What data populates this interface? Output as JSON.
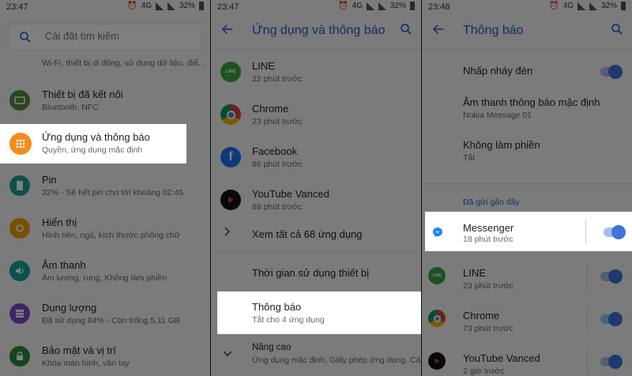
{
  "status": {
    "panel1_time": "23:47",
    "panel2_time": "23:47",
    "panel3_time": "23:48",
    "network": "4G",
    "battery": "32%"
  },
  "panel1": {
    "search_placeholder": "Cài đặt tìm kiếm",
    "partial_top_subtitle": "Wi-Fi, thiết bị di động, sử dụng dữ liệu, điể...",
    "items": [
      {
        "title": "Thiết bị đã kết nối",
        "subtitle": "Bluetooth, NFC",
        "color": "#5b8c3a"
      },
      {
        "title": "Ứng dụng và thông báo",
        "subtitle": "Quyền, ứng dụng mặc định",
        "color": "#f48c1c"
      },
      {
        "title": "Pin",
        "subtitle": "32% - Sẽ hết pin cho tới khoảng 02:45",
        "color": "#1aa08c"
      },
      {
        "title": "Hiển thị",
        "subtitle": "Hình nền, ngủ, kích thước phông chữ",
        "color": "#f0a000"
      },
      {
        "title": "Âm thanh",
        "subtitle": "Âm lượng, rung, Không làm phiền",
        "color": "#16a39a"
      },
      {
        "title": "Dung lượng",
        "subtitle": "Đã sử dụng 84% - Còn trống 5,11 GB",
        "color": "#7b4fc8"
      },
      {
        "title": "Bảo mật và vị trí",
        "subtitle": "Khóa màn hình, vân tay",
        "color": "#2e8b3c"
      }
    ]
  },
  "panel2": {
    "title": "Ứng dụng và thông báo",
    "apps": [
      {
        "name": "LINE",
        "time": "22 phút trước",
        "color": "#3aa640"
      },
      {
        "name": "Chrome",
        "time": "23 phút trước",
        "color": "#db4437"
      },
      {
        "name": "Facebook",
        "time": "86 phút trước",
        "color": "#1877f2"
      },
      {
        "name": "YouTube Vanced",
        "time": "88 phút trước",
        "color": "#111111"
      }
    ],
    "see_all": "Xem tất cả 68 ứng dụng",
    "screen_time": "Thời gian sử dụng thiết bị",
    "notifications_title": "Thông báo",
    "notifications_sub": "Tắt cho 4 ứng dụng",
    "advanced_title": "Nâng cao",
    "advanced_sub": "Ứng dụng mặc định, Giấy phép ứng dụng, Cản..."
  },
  "panel3": {
    "title": "Thông báo",
    "blink_light": "Nhấp nháy đèn",
    "default_sound": "Âm thanh thông báo mặc định",
    "default_sound_value": "Nokia Message 01",
    "dnd": "Không làm phiền",
    "dnd_value": "Tắt",
    "recent_header": "Đã gửi gần đây",
    "recent": [
      {
        "name": "Messenger",
        "time": "18 phút trước",
        "color": "#1e88e5"
      },
      {
        "name": "LINE",
        "time": "23 phút trước",
        "color": "#3aa640"
      },
      {
        "name": "Chrome",
        "time": "73 phút trước",
        "color": "#db4437"
      },
      {
        "name": "YouTube Vanced",
        "time": "2 giờ trước",
        "color": "#111111"
      }
    ]
  }
}
